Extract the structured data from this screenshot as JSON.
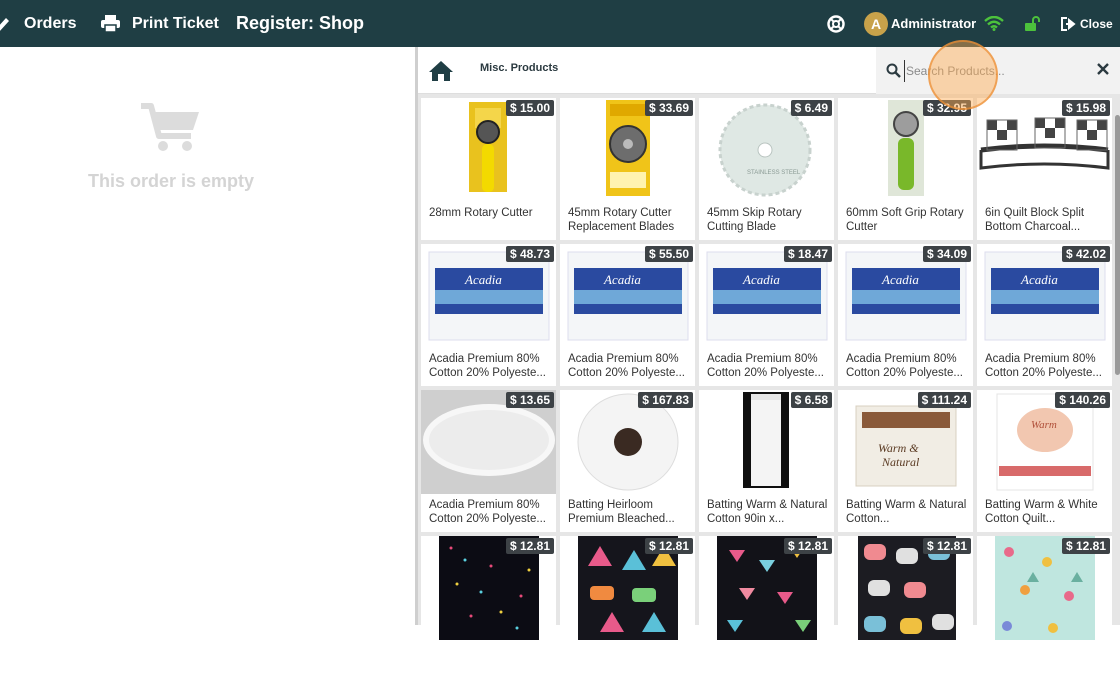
{
  "topbar": {
    "orders_label": "Orders",
    "print_label": "Print Ticket",
    "register_label": "Register: Shop",
    "user_initial": "A",
    "user_name": "Administrator",
    "close_label": "Close",
    "colors": {
      "bar": "#1f3e44",
      "wifi": "#4cc23c",
      "lock": "#4cc23c",
      "avatar": "#c8a24a"
    }
  },
  "order": {
    "empty_message": "This order is empty",
    "icon": "cart-icon"
  },
  "products": {
    "breadcrumb": "Misc. Products",
    "search_placeholder": "Search Products...",
    "items": [
      {
        "name": "28mm Rotary Cutter",
        "price": "$ 15.00",
        "image": "rotary-cutter-yellow"
      },
      {
        "name": "45mm Rotary Cutter Replacement Blades",
        "price": "$ 33.69",
        "image": "blade-package"
      },
      {
        "name": "45mm Skip Rotary Cutting Blade",
        "price": "$ 6.49",
        "image": "skip-blade"
      },
      {
        "name": "60mm Soft Grip Rotary Cutter",
        "price": "$ 32.95",
        "image": "rotary-cutter-green"
      },
      {
        "name": "6in Quilt Block Split Bottom Charcoal...",
        "price": "$ 15.98",
        "image": "quilt-block-holder"
      },
      {
        "name": "Acadia Premium 80% Cotton 20% Polyeste...",
        "price": "$ 48.73",
        "image": "acadia-batting"
      },
      {
        "name": "Acadia Premium 80% Cotton 20% Polyeste...",
        "price": "$ 55.50",
        "image": "acadia-batting"
      },
      {
        "name": "Acadia Premium 80% Cotton 20% Polyeste...",
        "price": "$ 18.47",
        "image": "acadia-batting"
      },
      {
        "name": "Acadia Premium 80% Cotton 20% Polyeste...",
        "price": "$ 34.09",
        "image": "acadia-batting"
      },
      {
        "name": "Acadia Premium 80% Cotton 20% Polyeste...",
        "price": "$ 42.02",
        "image": "acadia-batting"
      },
      {
        "name": "Acadia Premium 80% Cotton 20% Polyeste...",
        "price": "$ 13.65",
        "image": "batting-roll"
      },
      {
        "name": "Batting Heirloom Premium Bleached...",
        "price": "$ 167.83",
        "image": "batting-roll-end"
      },
      {
        "name": "Batting Warm & Natural Cotton 90in x...",
        "price": "$ 6.58",
        "image": "batting-tall-roll"
      },
      {
        "name": "Batting Warm & Natural Cotton...",
        "price": "$ 111.24",
        "image": "warm-natural-package"
      },
      {
        "name": "Batting Warm & White Cotton Quilt...",
        "price": "$ 140.26",
        "image": "warm-white-package"
      },
      {
        "name": "",
        "price": "$ 12.81",
        "image": "fabric-black-dots"
      },
      {
        "name": "",
        "price": "$ 12.81",
        "image": "fabric-black-campers"
      },
      {
        "name": "",
        "price": "$ 12.81",
        "image": "fabric-black-hearts"
      },
      {
        "name": "",
        "price": "$ 12.81",
        "image": "fabric-black-vans"
      },
      {
        "name": "",
        "price": "$ 12.81",
        "image": "fabric-mint-flowers"
      }
    ]
  }
}
